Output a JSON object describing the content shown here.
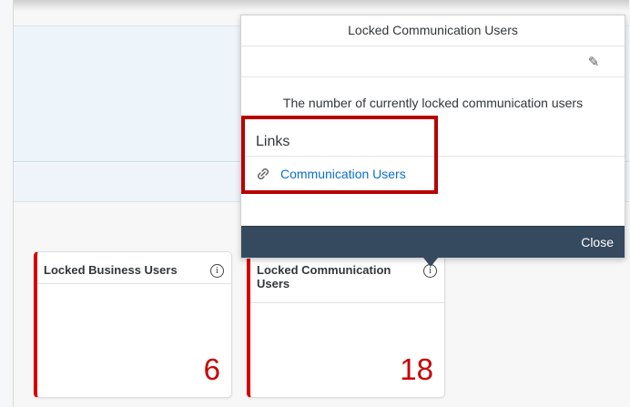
{
  "tiles": [
    {
      "title": "Locked Business Users",
      "value": "6",
      "info_icon": "info-icon"
    },
    {
      "title": "Locked Communication Users",
      "value": "18",
      "info_icon": "info-icon"
    }
  ],
  "popover": {
    "title": "Locked Communication Users",
    "edit_icon": "pencil-icon",
    "description": "The number of currently locked communication users",
    "links_heading": "Links",
    "links": [
      {
        "label": "Communication Users",
        "icon": "link-icon"
      }
    ],
    "close_label": "Close"
  },
  "colors": {
    "critical_red": "#c80000",
    "highlight_red": "#b80000",
    "link_blue": "#0a6ed1",
    "footer_dark": "#354a5f"
  }
}
